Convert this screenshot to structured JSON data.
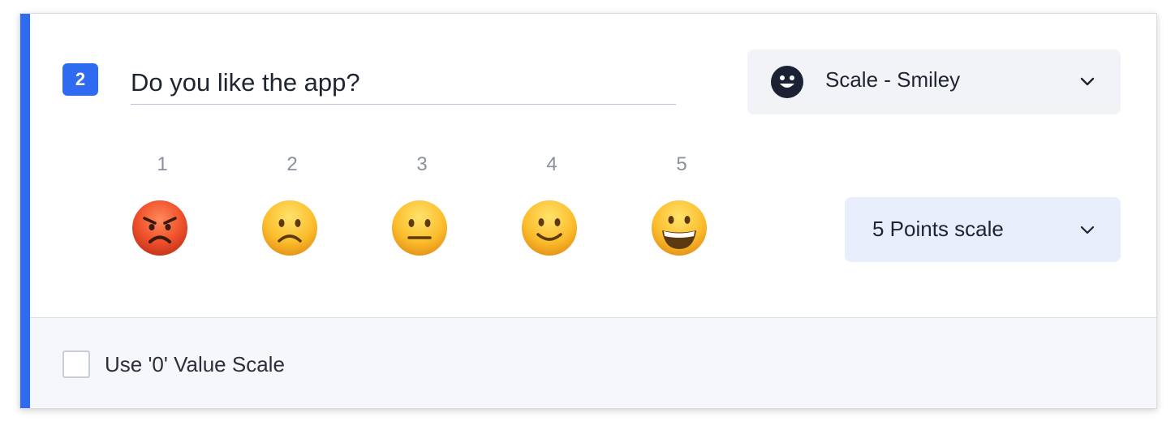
{
  "question": {
    "number": "2",
    "text": "Do you like the app?"
  },
  "question_type": {
    "label": "Scale - Smiley",
    "icon": "smiley-face-icon"
  },
  "scale": {
    "points": [
      {
        "number": "1",
        "emoji": "angry-face-icon"
      },
      {
        "number": "2",
        "emoji": "frowning-face-icon"
      },
      {
        "number": "3",
        "emoji": "neutral-face-icon"
      },
      {
        "number": "4",
        "emoji": "slightly-smiling-face-icon"
      },
      {
        "number": "5",
        "emoji": "grinning-face-icon"
      }
    ],
    "points_select_label": "5 Points scale"
  },
  "footer": {
    "zero_scale_label": "Use '0' Value Scale",
    "zero_scale_checked": false
  },
  "colors": {
    "accent": "#2f6bf0",
    "select_bg": "#f1f3f7",
    "points_select_bg": "#e8eefb"
  }
}
